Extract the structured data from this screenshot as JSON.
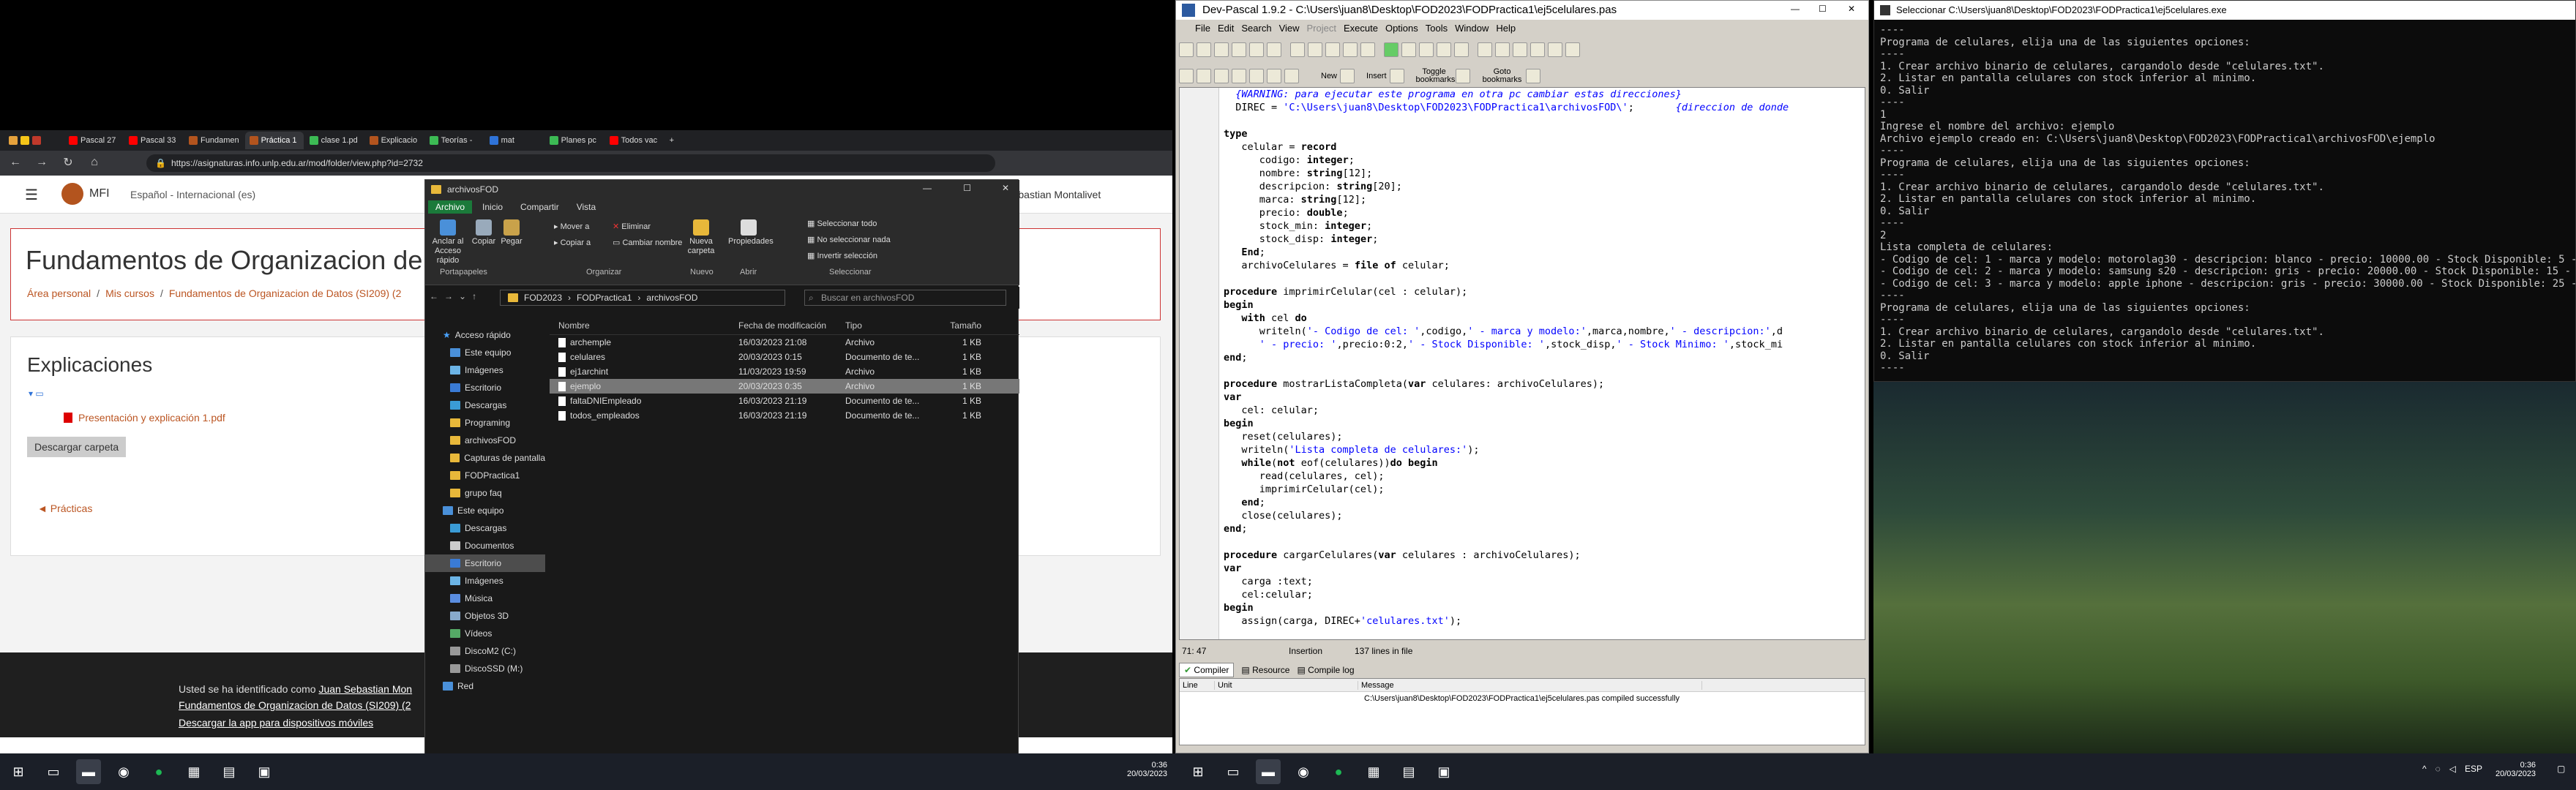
{
  "browser": {
    "tabs": [
      "Pascal 27",
      "Pascal 33",
      "Fundamen",
      "Práctica 1",
      "clase 1.pd",
      "Explicacio",
      "Teorías -",
      "mat",
      "Planes pc",
      "Todos vac"
    ],
    "url": "https://asignaturas.info.unlp.edu.ar/mod/folder/view.php?id=2732",
    "site_name": "MFI",
    "language": "Español - Internacional (es)",
    "user_name": "Juan Sebastian Montalivet",
    "course_title": "Fundamentos de Organizacion de",
    "breadcrumb": [
      "Área personal",
      "Mis cursos",
      "Fundamentos de Organizacion de Datos (SI209) (2"
    ],
    "section_title": "Explicaciones",
    "file_link": "Presentación y explicación 1.pdf",
    "download_button": "Descargar carpeta",
    "prev_link": "◄ Prácticas",
    "footer": {
      "logged_prefix": "Usted se ha identificado como",
      "logged_user": "Juan Sebastian Mon",
      "course_link": "Fundamentos de Organizacion de Datos (SI209) (2",
      "app_link": "Descargar la app para dispositivos móviles"
    }
  },
  "explorer": {
    "title": "archivosFOD",
    "menu": [
      "Archivo",
      "Inicio",
      "Compartir",
      "Vista"
    ],
    "ribbon": {
      "pin": "Anclar al Acceso rápido",
      "copy": "Copiar",
      "paste": "Pegar",
      "move": "Mover a",
      "copy_to": "Copiar a",
      "delete": "Eliminar",
      "rename": "Cambiar nombre",
      "new_folder": "Nueva carpeta",
      "properties": "Propiedades",
      "select_all": "Seleccionar todo",
      "select_none": "No seleccionar nada",
      "invert": "Invertir selección",
      "groups": [
        "Portapapeles",
        "Organizar",
        "Nuevo",
        "Abrir",
        "Seleccionar"
      ]
    },
    "path": [
      "FOD2023",
      "FODPractica1",
      "archivosFOD"
    ],
    "search_placeholder": "Buscar en archivosFOD",
    "sidebar": [
      "Acceso rápido",
      "Este equipo",
      "Imágenes",
      "Escritorio",
      "Descargas",
      "Programing",
      "archivosFOD",
      "Capturas de pantalla",
      "FODPractica1",
      "grupo faq",
      "Este equipo",
      "Descargas",
      "Documentos",
      "Escritorio",
      "Imágenes",
      "Música",
      "Objetos 3D",
      "Vídeos",
      "DiscoM2 (C:)",
      "DiscoSSD (M:)",
      "Red"
    ],
    "columns": [
      "Nombre",
      "Fecha de modificación",
      "Tipo",
      "Tamaño"
    ],
    "files": [
      {
        "name": "archemple",
        "date": "16/03/2023 21:08",
        "type": "Archivo",
        "size": "1 KB"
      },
      {
        "name": "celulares",
        "date": "20/03/2023 0:15",
        "type": "Documento de te...",
        "size": "1 KB"
      },
      {
        "name": "ej1archint",
        "date": "11/03/2023 19:59",
        "type": "Archivo",
        "size": "1 KB"
      },
      {
        "name": "ejemplo",
        "date": "20/03/2023 0:35",
        "type": "Archivo",
        "size": "1 KB"
      },
      {
        "name": "faltaDNIEmpleado",
        "date": "16/03/2023 21:19",
        "type": "Documento de te...",
        "size": "1 KB"
      },
      {
        "name": "todos_empleados",
        "date": "16/03/2023 21:19",
        "type": "Documento de te...",
        "size": "1 KB"
      }
    ]
  },
  "devpascal": {
    "title": "Dev-Pascal 1.9.2 - C:\\Users\\juan8\\Desktop\\FOD2023\\FODPractica1\\ej5celulares.pas",
    "menu": [
      "File",
      "Edit",
      "Search",
      "View",
      "Project",
      "Execute",
      "Options",
      "Tools",
      "Window",
      "Help"
    ],
    "toolbar_labels": [
      "New",
      "Insert",
      "Toggle bookmarks",
      "Goto bookmarks"
    ],
    "line_numbers": [
      "",
      "",
      "",
      "",
      "",
      "",
      "",
      "",
      "",
      "",
      "",
      "",
      "",
      "",
      "",
      "",
      "",
      "",
      "",
      "",
      "",
      "",
      "",
      "",
      "",
      "",
      "",
      "",
      "",
      "",
      "",
      "",
      "",
      "",
      "",
      "",
      "",
      "",
      "",
      "",
      ""
    ],
    "code": [
      "  {WARNING: para ejecutar este programa en otra pc cambiar estas direcciones}",
      "  DIREC = 'C:\\Users\\juan8\\Desktop\\FOD2023\\FODPractica1\\archivosFOD\\';       {direccion de donde",
      "",
      "type",
      "   celular = record",
      "      codigo: integer;",
      "      nombre: string[12];",
      "      descripcion: string[20];",
      "      marca: string[12];",
      "      precio: double;",
      "      stock_min: integer;",
      "      stock_disp: integer;",
      "   End;",
      "   archivoCelulares = file of celular;",
      "",
      "procedure imprimirCelular(cel : celular);",
      "begin",
      "   with cel do",
      "      writeln('- Codigo de cel: ',codigo,' - marca y modelo:',marca,nombre,' - descripcion:',d",
      "      ' - precio: ',precio:0:2,' - Stock Disponible: ',stock_disp,' - Stock Minimo: ',stock_mi",
      "end;",
      "",
      "procedure mostrarListaCompleta(var celulares: archivoCelulares);",
      "var",
      "   cel: celular;",
      "begin",
      "   reset(celulares);",
      "   writeln('Lista completa de celulares:');",
      "   while(not eof(celulares))do begin",
      "      read(celulares, cel);",
      "      imprimirCelular(cel);",
      "   end;",
      "   close(celulares);",
      "end;",
      "",
      "procedure cargarCelulares(var celulares : archivoCelulares);",
      "var",
      "   carga :text;",
      "   cel:celular;",
      "begin",
      "   assign(carga, DIREC+'celulares.txt');"
    ],
    "status": {
      "pos": "71: 47",
      "mode": "Insertion",
      "lines": "137 lines in file"
    },
    "bottom_tabs": [
      "Compiler",
      "Resource",
      "Compile log"
    ],
    "log_columns": [
      "Line",
      "Unit",
      "Message"
    ],
    "log_message": "C:\\Users\\juan8\\Desktop\\FOD2023\\FODPractica1\\ej5celulares.pas compiled successfully"
  },
  "console": {
    "title": "Seleccionar C:\\Users\\juan8\\Desktop\\FOD2023\\FODPractica1\\ej5celulares.exe",
    "lines": [
      "----",
      "Programa de celulares, elija una de las siguientes opciones:",
      "----",
      "1. Crear archivo binario de celulares, cargandolo desde \"celulares.txt\".",
      "2. Listar en pantalla celulares con stock inferior al minimo.",
      "0. Salir",
      "----",
      "1",
      "Ingrese el nombre del archivo: ejemplo",
      "Archivo ejemplo creado en: C:\\Users\\juan8\\Desktop\\FOD2023\\FODPractica1\\archivosFOD\\ejemplo",
      "----",
      "Programa de celulares, elija una de las siguientes opciones:",
      "----",
      "1. Crear archivo binario de celulares, cargandolo desde \"celulares.txt\".",
      "2. Listar en pantalla celulares con stock inferior al minimo.",
      "0. Salir",
      "----",
      "2",
      "Lista completa de celulares:",
      "- Codigo de cel: 1 - marca y modelo: motorolag30 - descripcion: blanco - precio: 10000.00 - Stock Disponible: 5 - Stoc",
      "- Codigo de cel: 2 - marca y modelo: samsung s20 - descripcion: gris - precio: 20000.00 - Stock Disponible: 15 - Stock",
      "- Codigo de cel: 3 - marca y modelo: apple iphone - descripcion: gris - precio: 30000.00 - Stock Disponible: 25 - Stoc",
      "----",
      "Programa de celulares, elija una de las siguientes opciones:",
      "----",
      "1. Crear archivo binario de celulares, cargandolo desde \"celulares.txt\".",
      "2. Listar en pantalla celulares con stock inferior al minimo.",
      "0. Salir",
      "----"
    ]
  },
  "taskbar": {
    "left_time": "0:36",
    "left_date": "20/03/2023",
    "right_lang": "ESP",
    "right_time": "0:36",
    "right_date": "20/03/2023"
  },
  "colors": {
    "moodle_accent": "#b3541e",
    "explorer_selected": "#1b7a3a",
    "keyword": "#000000",
    "string": "#0000ff"
  }
}
